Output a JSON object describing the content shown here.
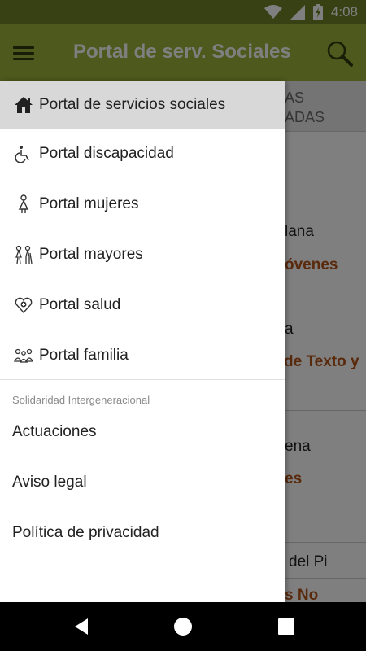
{
  "status_bar": {
    "time": "4:08"
  },
  "app_bar": {
    "title": "Portal de serv. Sociales",
    "menu_icon": "hamburger-menu-icon",
    "search_icon": "search-icon"
  },
  "background": {
    "tab_label_line1": "AS",
    "tab_label_line2": "ADAS",
    "fragments": [
      {
        "text": "lana",
        "style": "dark"
      },
      {
        "text": "óvenes",
        "style": "orange"
      },
      {
        "text": "a",
        "style": "dark"
      },
      {
        "text": "de Texto y",
        "style": "orange"
      },
      {
        "text": "ena",
        "style": "dark"
      },
      {
        "text": "es",
        "style": "orange"
      },
      {
        "text": "del Pi",
        "style": "dark"
      },
      {
        "text": "s No",
        "style": "orange"
      }
    ]
  },
  "drawer": {
    "items": [
      {
        "label": "Portal de servicios sociales",
        "icon": "home-icon",
        "selected": true
      },
      {
        "label": "Portal discapacidad",
        "icon": "wheelchair-icon",
        "selected": false
      },
      {
        "label": "Portal mujeres",
        "icon": "woman-icon",
        "selected": false
      },
      {
        "label": "Portal mayores",
        "icon": "elderly-icon",
        "selected": false
      },
      {
        "label": "Portal salud",
        "icon": "health-heart-icon",
        "selected": false
      },
      {
        "label": "Portal familia",
        "icon": "family-icon",
        "selected": false
      }
    ],
    "section_header": "Solidaridad Intergeneracional",
    "links": [
      {
        "label": "Actuaciones"
      },
      {
        "label": "Aviso legal"
      },
      {
        "label": "Política de privacidad"
      }
    ]
  },
  "nav_bar": {
    "back": "back-triangle-icon",
    "home": "home-circle-icon",
    "recents": "recents-square-icon"
  },
  "colors": {
    "status_bar": "#6f8226",
    "app_bar": "#9bb33a",
    "accent_orange": "#b4541a",
    "selected_item": "#d8d8d8"
  }
}
